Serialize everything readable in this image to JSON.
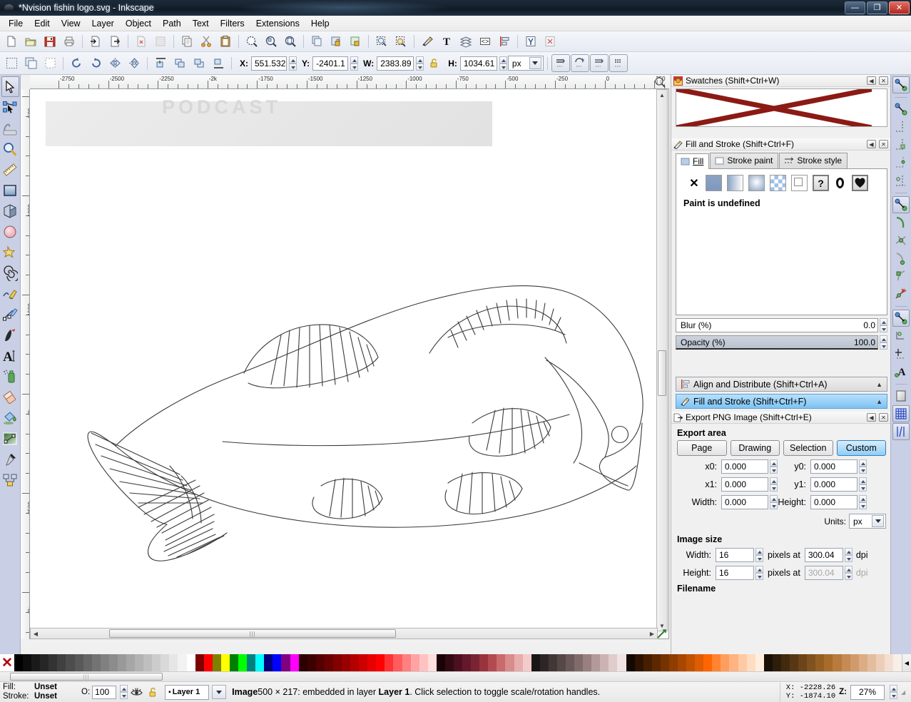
{
  "window": {
    "title": "*Nvision fishin logo.svg - Inkscape",
    "icon": "inkscape-logo-icon",
    "minimize_label": "—",
    "maximize_label": "❐",
    "close_label": "✕"
  },
  "menubar": {
    "items": [
      {
        "label": "File",
        "mnemonic": "F"
      },
      {
        "label": "Edit",
        "mnemonic": "E"
      },
      {
        "label": "View",
        "mnemonic": "V"
      },
      {
        "label": "Layer",
        "mnemonic": "L"
      },
      {
        "label": "Object",
        "mnemonic": "O"
      },
      {
        "label": "Path",
        "mnemonic": "P"
      },
      {
        "label": "Text",
        "mnemonic": "T"
      },
      {
        "label": "Filters",
        "mnemonic": "s"
      },
      {
        "label": "Extensions",
        "mnemonic": "n"
      },
      {
        "label": "Help",
        "mnemonic": "H"
      }
    ]
  },
  "command_bar": {
    "buttons": [
      "new-document-icon",
      "open-document-icon",
      "save-document-icon",
      "print-document-icon",
      "import-icon",
      "export-icon",
      "undo-icon",
      "redo-icon",
      "copy-icon",
      "cut-icon",
      "paste-icon",
      "zoom-selection-icon",
      "zoom-drawing-icon",
      "zoom-page-icon",
      "duplicate-icon",
      "group-icon",
      "ungroup-icon",
      "object-properties-icon",
      "object-transform-icon",
      "fill-stroke-icon",
      "text-tool-icon",
      "layers-icon",
      "xml-editor-icon",
      "align-distribute-icon",
      "preferences-icon",
      "document-properties-icon"
    ]
  },
  "select_toolbar": {
    "x_label": "X:",
    "x_value": "551.532",
    "y_label": "Y:",
    "y_value": "-2401.1",
    "w_label": "W:",
    "w_value": "2383.89",
    "lock_icon": "lock-open-icon",
    "h_label": "H:",
    "h_value": "1034.61",
    "units": "px",
    "affect_buttons": [
      "affect-stroke-width-icon",
      "affect-rounded-corners-icon",
      "affect-gradients-icon",
      "affect-patterns-icon"
    ],
    "select_all_icons": [
      "select-all-icon",
      "select-all-in-layers-icon",
      "deselect-icon",
      "rotate-ccw-icon",
      "rotate-cw-icon",
      "flip-horizontal-icon",
      "flip-vertical-icon",
      "raise-to-top-icon",
      "raise-icon",
      "lower-icon",
      "lower-to-bottom-icon"
    ]
  },
  "toolbox": {
    "tools": [
      {
        "name": "selector-tool",
        "icon": "arrow-cursor-icon",
        "active": true
      },
      {
        "name": "node-tool",
        "icon": "node-editor-icon",
        "active": false
      },
      {
        "name": "tweak-tool",
        "icon": "tweak-icon",
        "active": false
      },
      {
        "name": "zoom-tool",
        "icon": "magnifier-icon",
        "active": false
      },
      {
        "name": "measure-tool",
        "icon": "ruler-icon",
        "active": false
      },
      {
        "name": "rectangle-tool",
        "icon": "rectangle-icon",
        "active": false
      },
      {
        "name": "box3d-tool",
        "icon": "cube-3d-icon",
        "active": false
      },
      {
        "name": "ellipse-tool",
        "icon": "circle-icon",
        "active": false
      },
      {
        "name": "star-tool",
        "icon": "star-icon",
        "active": false
      },
      {
        "name": "spiral-tool",
        "icon": "spiral-icon",
        "active": false
      },
      {
        "name": "pencil-tool",
        "icon": "pencil-icon",
        "active": false
      },
      {
        "name": "bezier-tool",
        "icon": "bezier-pen-icon",
        "active": false
      },
      {
        "name": "calligraphy-tool",
        "icon": "calligraphy-pen-icon",
        "active": false
      },
      {
        "name": "text-tool",
        "icon": "text-a-icon",
        "active": false
      },
      {
        "name": "spray-tool",
        "icon": "spray-can-icon",
        "active": false
      },
      {
        "name": "eraser-tool",
        "icon": "eraser-icon",
        "active": false
      },
      {
        "name": "paintbucket-tool",
        "icon": "paint-bucket-icon",
        "active": false
      },
      {
        "name": "gradient-tool",
        "icon": "gradient-icon",
        "active": false
      },
      {
        "name": "dropper-tool",
        "icon": "eyedropper-icon",
        "active": false
      },
      {
        "name": "connector-tool",
        "icon": "connector-icon",
        "active": false
      }
    ]
  },
  "snapbar": {
    "buttons": [
      {
        "name": "enable-snapping",
        "icon": "snap-global-icon",
        "on": true
      },
      {
        "name": "snap-bounding-box",
        "icon": "snap-bbox-icon",
        "on": false
      },
      {
        "name": "snap-bbox-edge",
        "icon": "snap-bbox-edge-icon",
        "on": false
      },
      {
        "name": "snap-bbox-corner",
        "icon": "snap-bbox-corner-icon",
        "on": false
      },
      {
        "name": "snap-bbox-edge-midpoint",
        "icon": "snap-bbox-edge-mid-icon",
        "on": false
      },
      {
        "name": "snap-bbox-center",
        "icon": "snap-bbox-center-icon",
        "on": false
      },
      {
        "name": "snap-nodes-paths",
        "icon": "snap-nodes-icon",
        "on": true
      },
      {
        "name": "snap-path",
        "icon": "snap-path-icon",
        "on": false
      },
      {
        "name": "snap-path-intersections",
        "icon": "snap-path-intersect-icon",
        "on": false
      },
      {
        "name": "snap-cusp-nodes",
        "icon": "snap-cusp-node-icon",
        "on": false
      },
      {
        "name": "snap-smooth-nodes",
        "icon": "snap-smooth-node-icon",
        "on": false
      },
      {
        "name": "snap-midpoints",
        "icon": "snap-midpoint-icon",
        "on": false
      },
      {
        "name": "snap-others",
        "icon": "snap-others-icon",
        "on": true
      },
      {
        "name": "snap-object-centers",
        "icon": "snap-object-center-icon",
        "on": false
      },
      {
        "name": "snap-rotation-centers",
        "icon": "snap-rotation-center-icon",
        "on": false
      },
      {
        "name": "snap-text-baseline",
        "icon": "snap-text-baseline-icon",
        "on": false
      },
      {
        "name": "snap-page-border",
        "icon": "snap-page-border-icon",
        "on": false
      },
      {
        "name": "snap-grids",
        "icon": "snap-grid-icon",
        "on": true
      },
      {
        "name": "snap-guides",
        "icon": "snap-guide-icon",
        "on": true
      }
    ]
  },
  "canvas": {
    "hruler_labels": [
      "-2750",
      "-2500",
      "-2250",
      "-2k",
      "-1750",
      "-1500",
      "-1250",
      "-1000",
      "-750",
      "-500",
      "-250",
      "0",
      "250"
    ],
    "vruler_labels": [
      "500",
      "1000",
      "1500",
      "2k",
      "2500",
      "3k"
    ],
    "zoom_corner_icon": "zoom-1to1-icon",
    "artwork_alt": "line-drawing-of-a-trout-fish",
    "watermark_text": "PODCAST"
  },
  "dock": {
    "swatches": {
      "title": "Swatches (Shift+Ctrl+W)",
      "icon": "swatches-icon",
      "collapse_label": "◀",
      "close_label": "✕",
      "scroll_arrow": "◀",
      "swatch_color": "#8b1a14",
      "pattern": "x-cross-none-swatch"
    },
    "fill_stroke": {
      "title": "Fill and Stroke (Shift+Ctrl+F)",
      "icon": "fill-stroke-icon",
      "collapse_label": "◀",
      "close_label": "✕",
      "tabs": [
        {
          "label": "Fill",
          "mnemonic": "F",
          "icon": "fill-swatch-icon",
          "selected": true
        },
        {
          "label": "Stroke paint",
          "mnemonic": "S",
          "icon": "stroke-paint-icon",
          "selected": false
        },
        {
          "label": "Stroke style",
          "mnemonic": "y",
          "icon": "stroke-style-icon",
          "selected": false
        }
      ],
      "paint_types": [
        {
          "name": "no-paint",
          "icon": "x-icon",
          "selected": false
        },
        {
          "name": "flat-color",
          "icon": "flat-color-icon",
          "selected": false
        },
        {
          "name": "linear-gradient",
          "icon": "linear-gradient-icon",
          "selected": false
        },
        {
          "name": "radial-gradient",
          "icon": "radial-gradient-icon",
          "selected": false
        },
        {
          "name": "pattern",
          "icon": "pattern-icon",
          "selected": false
        },
        {
          "name": "swatch",
          "icon": "swatch-icon",
          "selected": false
        },
        {
          "name": "unknown-paint",
          "icon": "question-mark-icon",
          "selected": true
        },
        {
          "name": "fill-rule-nonzero",
          "icon": "fill-rule-nonzero-icon",
          "selected": false
        },
        {
          "name": "fill-rule-evenodd",
          "icon": "fill-rule-evenodd-icon",
          "selected": true
        }
      ],
      "status_text": "Paint is undefined",
      "blur_label": "Blur (%)",
      "blur_value": "0.0",
      "opacity_label": "Opacity (%)",
      "opacity_value": "100.0"
    },
    "collapsed_panels": [
      {
        "title": "Align and Distribute (Shift+Ctrl+A)",
        "icon": "align-distribute-icon",
        "active": false,
        "arrow": "▲"
      },
      {
        "title": "Fill and Stroke (Shift+Ctrl+F)",
        "icon": "fill-stroke-icon",
        "active": true,
        "arrow": "▲"
      }
    ],
    "export": {
      "title": "Export PNG Image (Shift+Ctrl+E)",
      "icon": "export-png-icon",
      "collapse_label": "◀",
      "close_label": "✕",
      "area_section_label": "Export area",
      "area_buttons": [
        {
          "label": "Page",
          "mnemonic": "P",
          "selected": false
        },
        {
          "label": "Drawing",
          "mnemonic": "D",
          "selected": false
        },
        {
          "label": "Selection",
          "mnemonic": "S",
          "selected": false
        },
        {
          "label": "Custom",
          "mnemonic": "C",
          "selected": true
        }
      ],
      "fields": [
        {
          "label": "x0:",
          "value": "0.000",
          "label2": "y0:",
          "value2": "0.000"
        },
        {
          "label": "x1:",
          "value": "0.000",
          "label2": "y1:",
          "value2": "0.000"
        },
        {
          "label": "Width:",
          "value": "0.000",
          "label2": "Height:",
          "value2": "0.000"
        }
      ],
      "units_label": "Units:",
      "units_value": "px",
      "image_size_label": "Image size",
      "width_label": "Width:",
      "width_value": "16",
      "width_pixels_at": "pixels at",
      "width_dpi_value": "300.04",
      "width_dpi_label": "dpi",
      "height_label": "Height:",
      "height_value": "16",
      "height_pixels_at": "pixels at",
      "height_dpi_value": "300.04",
      "height_dpi_label": "dpi",
      "filename_label": "Filename"
    }
  },
  "palette": {
    "none_label": "✕",
    "scroll_arrow": "◀",
    "colors": [
      "#000000",
      "#0d0d0d",
      "#1a1a1a",
      "#262626",
      "#333333",
      "#404040",
      "#4d4d4d",
      "#595959",
      "#666666",
      "#737373",
      "#808080",
      "#8c8c8c",
      "#999999",
      "#a6a6a6",
      "#b3b3b3",
      "#bfbfbf",
      "#cccccc",
      "#d9d9d9",
      "#e6e6e6",
      "#f2f2f2",
      "#ffffff",
      "#800000",
      "#ff0000",
      "#808000",
      "#ffff00",
      "#008000",
      "#00ff00",
      "#008080",
      "#00ffff",
      "#000080",
      "#0000ff",
      "#800080",
      "#ff00ff",
      "#2b0000",
      "#3d0000",
      "#540000",
      "#6b0000",
      "#820000",
      "#990000",
      "#b30000",
      "#cc0000",
      "#e60000",
      "#ff0000",
      "#ff3333",
      "#ff5c5c",
      "#ff8080",
      "#ffa3a3",
      "#ffc2c2",
      "#ffdede",
      "#1a0307",
      "#330a12",
      "#4d1020",
      "#66182b",
      "#7a2433",
      "#99333d",
      "#b34a52",
      "#c96a6d",
      "#d98c8c",
      "#e8adad",
      "#f2cccc",
      "#1a1616",
      "#2e2626",
      "#423737",
      "#574747",
      "#6b5858",
      "#806b6b",
      "#998080",
      "#b39999",
      "#ccb3b3",
      "#e0cccc",
      "#efe3e3",
      "#140900",
      "#2e1400",
      "#471e00",
      "#5c2800",
      "#753300",
      "#8f3d00",
      "#a84700",
      "#c25200",
      "#e05c00",
      "#ff6600",
      "#ff8533",
      "#ff9e5c",
      "#ffb380",
      "#ffc9a3",
      "#ffdcc2",
      "#ffeede",
      "#1a1005",
      "#2e1d0a",
      "#422a0f",
      "#573714",
      "#6b4419",
      "#80521e",
      "#945f23",
      "#a86c28",
      "#b87a3d",
      "#c68a54",
      "#d19a6b",
      "#dbac85",
      "#e4bd9e",
      "#ecceb8",
      "#f3dfd2",
      "#f9efe9"
    ]
  },
  "statusbar": {
    "fill_label": "Fill:",
    "fill_value": "Unset",
    "stroke_label": "Stroke:",
    "stroke_value": "Unset",
    "opacity_label": "O:",
    "opacity_value": "100",
    "visibility_icon": "eye-hidden-icon",
    "lock_icon": "lock-open-icon",
    "layer_name": "Layer 1",
    "status_message_parts": {
      "p1": "Image",
      "p2": "500 × 217",
      "p3": ": embedded in layer",
      "p4": "Layer 1",
      "p5": ". Click selection to toggle scale/rotation handles."
    },
    "coord_x_label": "X:",
    "coord_x_value": "-2228.26",
    "coord_y_label": "Y:",
    "coord_y_value": "-1874.10",
    "zoom_label": "Z:",
    "zoom_value": "27%"
  }
}
